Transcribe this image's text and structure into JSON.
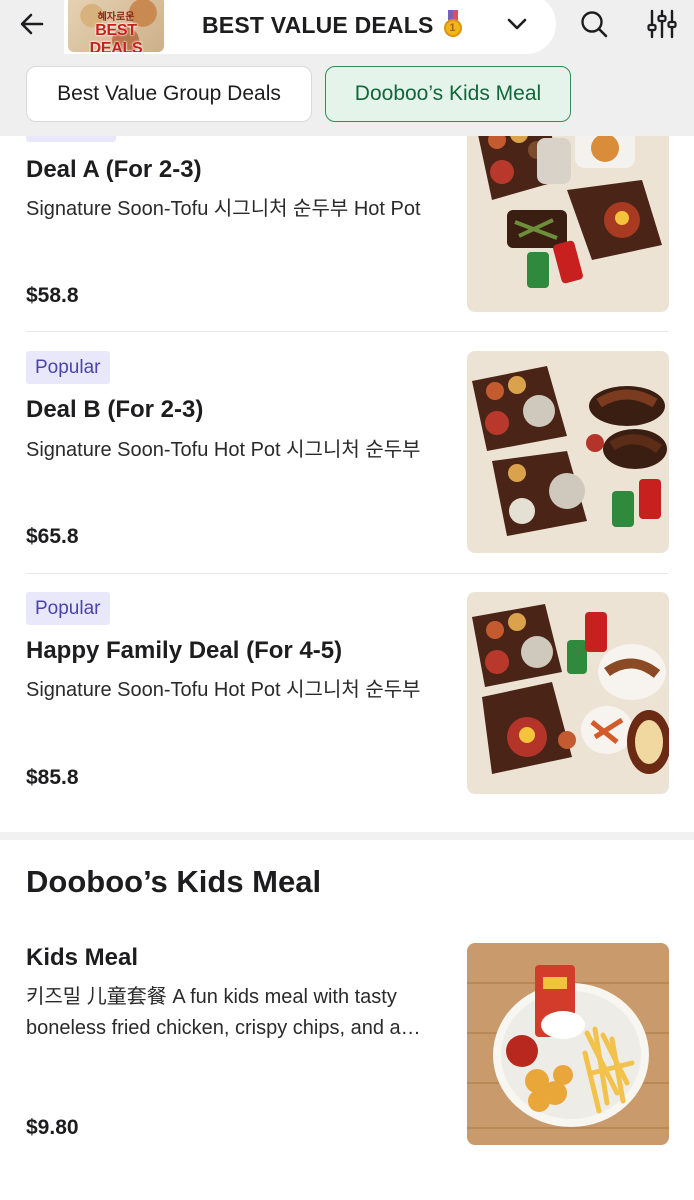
{
  "header": {
    "back_icon": "arrow-left-icon",
    "logo": {
      "small_text": "혜자로운",
      "big_text": "BEST DEALS"
    },
    "title": "BEST VALUE DEALS",
    "title_emoji_icon": "first-place-medal-icon",
    "dropdown_icon": "chevron-down-icon",
    "search_icon": "search-icon",
    "filter_icon": "sliders-icon"
  },
  "chips": [
    {
      "label": "Best Value Group Deals",
      "selected": false
    },
    {
      "label": "Dooboo’s Kids Meal",
      "selected": true
    }
  ],
  "sections": [
    {
      "title": "",
      "items": [
        {
          "badge": "",
          "name": "Deal A (For 2-3)",
          "description": "Signature Soon-Tofu 시그니처 순두부 Hot Pot",
          "price": "$58.8"
        },
        {
          "badge": "Popular",
          "name": "Deal B (For 2-3)",
          "description": "Signature Soon-Tofu Hot Pot 시그니처 순두부",
          "price": "$65.8"
        },
        {
          "badge": "Popular",
          "name": "Happy Family Deal (For 4-5)",
          "description": "Signature Soon-Tofu Hot Pot 시그니처 순두부",
          "price": "$85.8"
        }
      ]
    },
    {
      "title": "Dooboo’s Kids Meal",
      "items": [
        {
          "badge": "",
          "name": "Kids Meal",
          "description": "키즈밀 儿童套餐 A fun kids meal with tasty boneless fried chicken, crispy chips, and a drink",
          "price": "$9.80"
        }
      ]
    }
  ],
  "colors": {
    "accent_green": "#2f8f57",
    "chip_selected_bg": "#e4f4ea",
    "badge_bg": "#e9e8fb",
    "badge_text": "#4b44a8"
  }
}
